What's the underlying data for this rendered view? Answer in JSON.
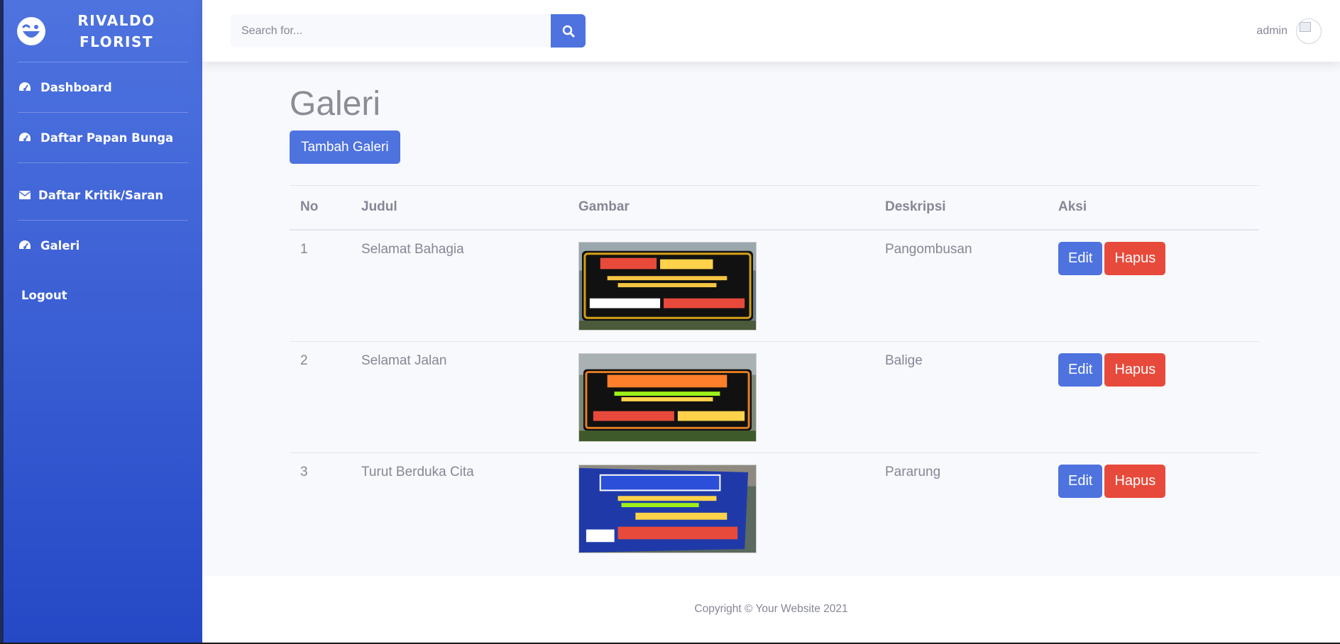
{
  "brand": {
    "line1": "RIVALDO",
    "line2": "FLORIST",
    "icon": "laugh-wink-icon"
  },
  "sidebar": {
    "items": [
      {
        "label": "Dashboard",
        "icon": "tachometer-icon"
      },
      {
        "label": "Daftar Papan Bunga",
        "icon": "tachometer-icon"
      },
      {
        "label": "Daftar Kritik/Saran",
        "icon": "envelope-icon"
      },
      {
        "label": "Galeri",
        "icon": "tachometer-icon"
      }
    ],
    "logout": "Logout"
  },
  "topbar": {
    "search_placeholder": "Search for...",
    "user_name": "admin"
  },
  "page": {
    "title": "Galeri",
    "add_button": "Tambah Galeri"
  },
  "table": {
    "headers": [
      "No",
      "Judul",
      "Gambar",
      "Deskripsi",
      "Aksi"
    ],
    "rows": [
      {
        "no": "1",
        "judul": "Selamat Bahagia",
        "deskripsi": "Pangombusan"
      },
      {
        "no": "2",
        "judul": "Selamat Jalan",
        "deskripsi": "Balige"
      },
      {
        "no": "3",
        "judul": "Turut Berduka Cita",
        "deskripsi": "Pararung"
      }
    ],
    "edit_label": "Edit",
    "delete_label": "Hapus"
  },
  "footer": {
    "copyright": "Copyright © Your Website 2021"
  },
  "colors": {
    "primary": "#4e73df",
    "danger": "#e74a3b",
    "text": "#858796"
  }
}
